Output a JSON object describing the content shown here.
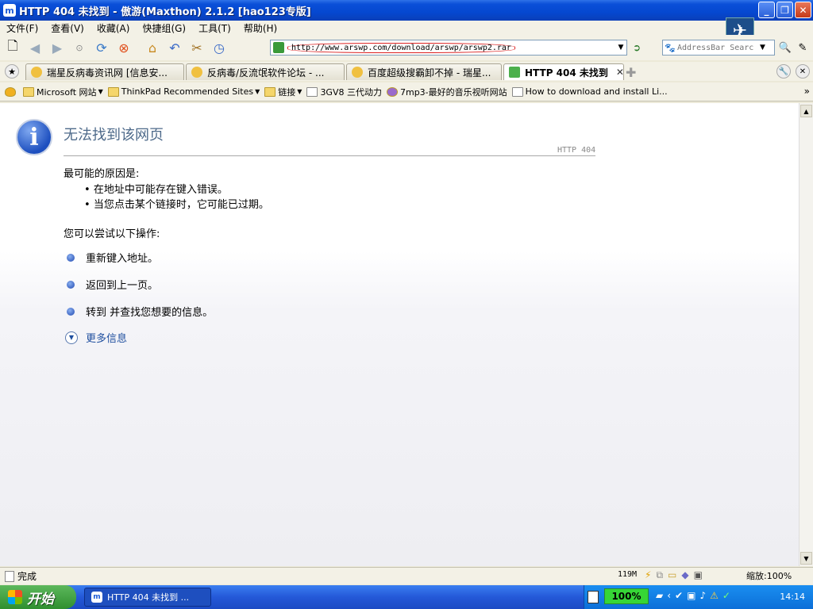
{
  "window": {
    "title": "HTTP 404 未找到 - 傲游(Maxthon) 2.1.2 [hao123专版]",
    "app_icon": "m"
  },
  "menu": [
    "文件(F)",
    "查看(V)",
    "收藏(A)",
    "快捷组(G)",
    "工具(T)",
    "帮助(H)"
  ],
  "address": {
    "url": "http://www.arswp.com/download/arswp/arswp2.rar"
  },
  "search": {
    "placeholder": "AddressBar Searc"
  },
  "tabs": [
    {
      "label": "瑞星反病毒资讯网 [信息安...",
      "active": false
    },
    {
      "label": "反病毒/反流氓软件论坛 - ...",
      "active": false
    },
    {
      "label": "百度超级搜霸卸不掉 - 瑞星...",
      "active": false
    },
    {
      "label": "HTTP 404 未找到",
      "active": true
    }
  ],
  "favorites": [
    {
      "label": "Microsoft 网站",
      "icon": "folder",
      "dropdown": true
    },
    {
      "label": "ThinkPad Recommended Sites",
      "icon": "folder",
      "dropdown": true
    },
    {
      "label": "链接",
      "icon": "folder",
      "dropdown": true
    },
    {
      "label": "3GV8 三代动力",
      "icon": "page",
      "dropdown": false
    },
    {
      "label": "7mp3-最好的音乐视听网站",
      "icon": "round",
      "dropdown": false
    },
    {
      "label": "How to download and install Li...",
      "icon": "page",
      "dropdown": false
    }
  ],
  "error": {
    "title": "无法找到该网页",
    "code": "HTTP 404",
    "reasons_header": "最可能的原因是:",
    "reasons": [
      "在地址中可能存在键入错误。",
      "当您点击某个链接时，它可能已过期。"
    ],
    "actions_header": "您可以尝试以下操作:",
    "actions": [
      "重新键入地址。",
      "返回到上一页。",
      "转到  并查找您想要的信息。"
    ],
    "more_info": "更多信息"
  },
  "status": {
    "text": "完成",
    "memory": "119M",
    "zoom": "缩放:100%"
  },
  "taskbar": {
    "start_label": "开始",
    "task_label": "HTTP 404 未找到 ...",
    "battery": "100%",
    "clock": "14:14"
  }
}
